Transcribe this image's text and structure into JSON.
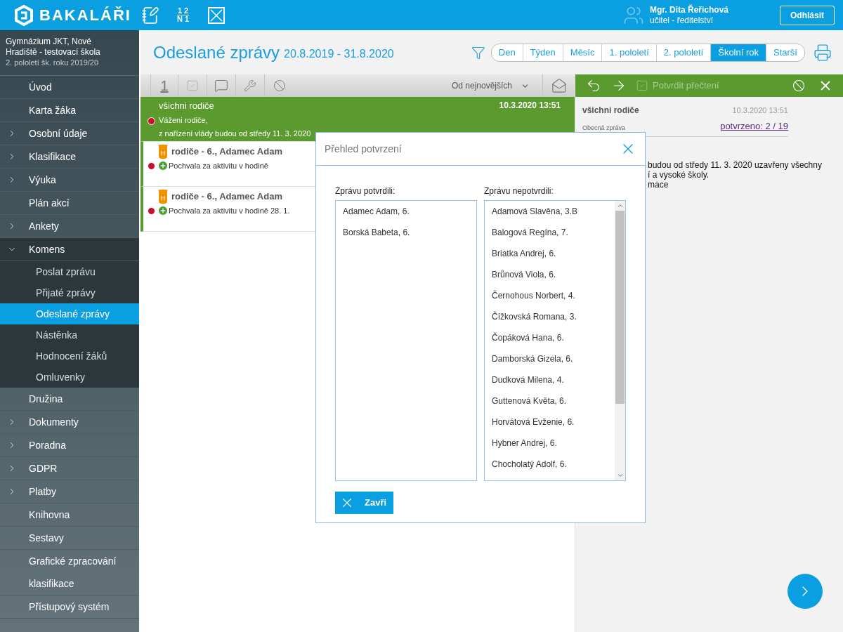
{
  "header": {
    "logo": "BAKALÁŘI",
    "grades_icon": [
      "1 2",
      "N 1"
    ],
    "user_name": "Mgr. Dita Řeřichová",
    "user_role": "učitel - ředitelství",
    "logout": "Odhlásit"
  },
  "sidebar": {
    "school": "Gymnázium JKT, Nové Hradiště - testovací škola",
    "term": "2. pololetí šk. roku 2019/20",
    "items": [
      {
        "label": "Úvod",
        "expandable": false,
        "expanded": false
      },
      {
        "label": "Karta žáka",
        "expandable": false,
        "expanded": false
      },
      {
        "label": "Osobní údaje",
        "expandable": true,
        "expanded": false
      },
      {
        "label": "Klasifikace",
        "expandable": true,
        "expanded": false
      },
      {
        "label": "Výuka",
        "expandable": true,
        "expanded": false
      },
      {
        "label": "Plán akcí",
        "expandable": false,
        "expanded": false
      },
      {
        "label": "Ankety",
        "expandable": true,
        "expanded": false
      },
      {
        "label": "Komens",
        "expandable": true,
        "expanded": true,
        "children": [
          {
            "label": "Poslat zprávu",
            "selected": false
          },
          {
            "label": "Přijaté zprávy",
            "selected": false
          },
          {
            "label": "Odeslané zprávy",
            "selected": true
          },
          {
            "label": "Nástěnka",
            "selected": false
          },
          {
            "label": "Hodnocení žáků",
            "selected": false
          },
          {
            "label": "Omluvenky",
            "selected": false
          }
        ]
      },
      {
        "label": "Družina",
        "expandable": false,
        "expanded": false
      },
      {
        "label": "Dokumenty",
        "expandable": true,
        "expanded": false
      },
      {
        "label": "Poradna",
        "expandable": true,
        "expanded": false
      },
      {
        "label": "GDPR",
        "expandable": true,
        "expanded": false
      },
      {
        "label": "Platby",
        "expandable": true,
        "expanded": false
      },
      {
        "label": "Knihovna",
        "expandable": false,
        "expanded": false
      },
      {
        "label": "Sestavy",
        "expandable": false,
        "expanded": false
      },
      {
        "label": "Grafické zpracování klasifikace",
        "expandable": false,
        "expanded": false
      },
      {
        "label": "Přístupový systém",
        "expandable": false,
        "expanded": false
      }
    ]
  },
  "page": {
    "title": "Odeslané zprávy",
    "date_range": "20.8.2019 - 31.8.2020",
    "periods": [
      {
        "label": "Den",
        "selected": false
      },
      {
        "label": "Týden",
        "selected": false
      },
      {
        "label": "Měsíc",
        "selected": false
      },
      {
        "label": "1. pololetí",
        "selected": false
      },
      {
        "label": "2. pololetí",
        "selected": false
      },
      {
        "label": "Školní rok",
        "selected": true
      },
      {
        "label": "Starší",
        "selected": false
      }
    ]
  },
  "toolbar": {
    "number_button": "1",
    "sort": "Od nejnovějších"
  },
  "messages": [
    {
      "kind": "message",
      "selected": true,
      "unread": true,
      "recipient": "všichni rodiče",
      "date": "10.3.2020 13:51",
      "lines": [
        "Váženi rodiče,",
        "z nařízení vlády budou od středy 11. 3. 2020"
      ]
    },
    {
      "kind": "note",
      "selected": false,
      "unread": true,
      "tag": "H",
      "recipient": "rodiče - 6., Adamec Adam",
      "note": "Pochvala za aktivitu v hodině"
    },
    {
      "kind": "note",
      "selected": false,
      "unread": true,
      "tag": "H",
      "recipient": "rodiče - 6., Adamec Adam",
      "note": "Pochvala za aktivitu v hodině 28. 1."
    }
  ],
  "detail": {
    "confirm": {
      "label": "Potvrdit přečtení",
      "disabled": true
    },
    "recipient": "všichni rodiče",
    "date": "10.3.2020 13:51",
    "type": "Obecná zpráva",
    "confirmations": "potvrzeno: 2 / 19",
    "body": [
      "budou od středy 11. 3. 2020 uzavřeny všechny",
      "í a vysoké školy.",
      "mace"
    ]
  },
  "dialog": {
    "title": "Přehled potvrzení",
    "confirmed_heading": "Zprávu potvrdili:",
    "confirmed": [
      "Adamec Adam, 6.",
      "Borská Babeta, 6."
    ],
    "unconfirmed_heading": "Zprávu nepotvrdili:",
    "unconfirmed": [
      "Adamová Slavěna, 3.B",
      "Balogová Regína, 7.",
      "Briatka Andrej, 6.",
      "Brůnová Viola, 6.",
      "Černohous Norbert, 4.",
      "Čížkovská Romana, 3.",
      "Čopáková Hana, 6.",
      "Damborská Gizela, 6.",
      "Dudková Milena, 4.",
      "Guttenová Květa, 6.",
      "Horvátová Evženie, 6.",
      "Hybner Andrej, 6.",
      "Chocholatý Adolf, 6."
    ],
    "close": "Zavři"
  }
}
